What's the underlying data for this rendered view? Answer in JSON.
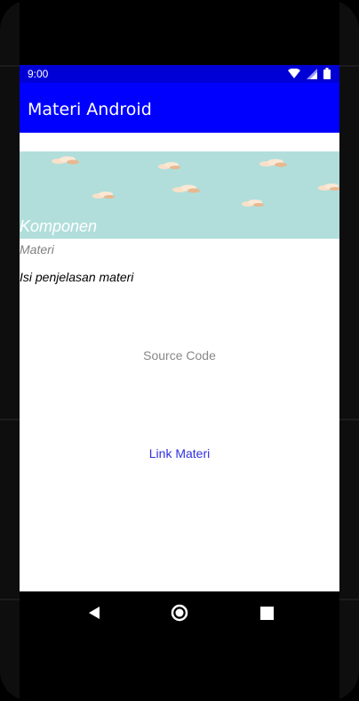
{
  "status_bar": {
    "time": "9:00",
    "icons": [
      "wifi-icon",
      "signal-icon",
      "battery-icon"
    ]
  },
  "app_bar": {
    "title": "Materi Android"
  },
  "banner": {
    "title": "Komponen",
    "background": "#b1dedb"
  },
  "content": {
    "subtitle": "Materi",
    "body": "Isi penjelasan materi",
    "source_code_label": "Source Code",
    "link_label": "Link Materi"
  },
  "nav_bar": {
    "icons": [
      "back-icon",
      "home-icon",
      "recents-icon"
    ]
  },
  "colors": {
    "app_bar": "#0000ff",
    "status_bar": "#0000d6",
    "link": "#3030e0"
  }
}
